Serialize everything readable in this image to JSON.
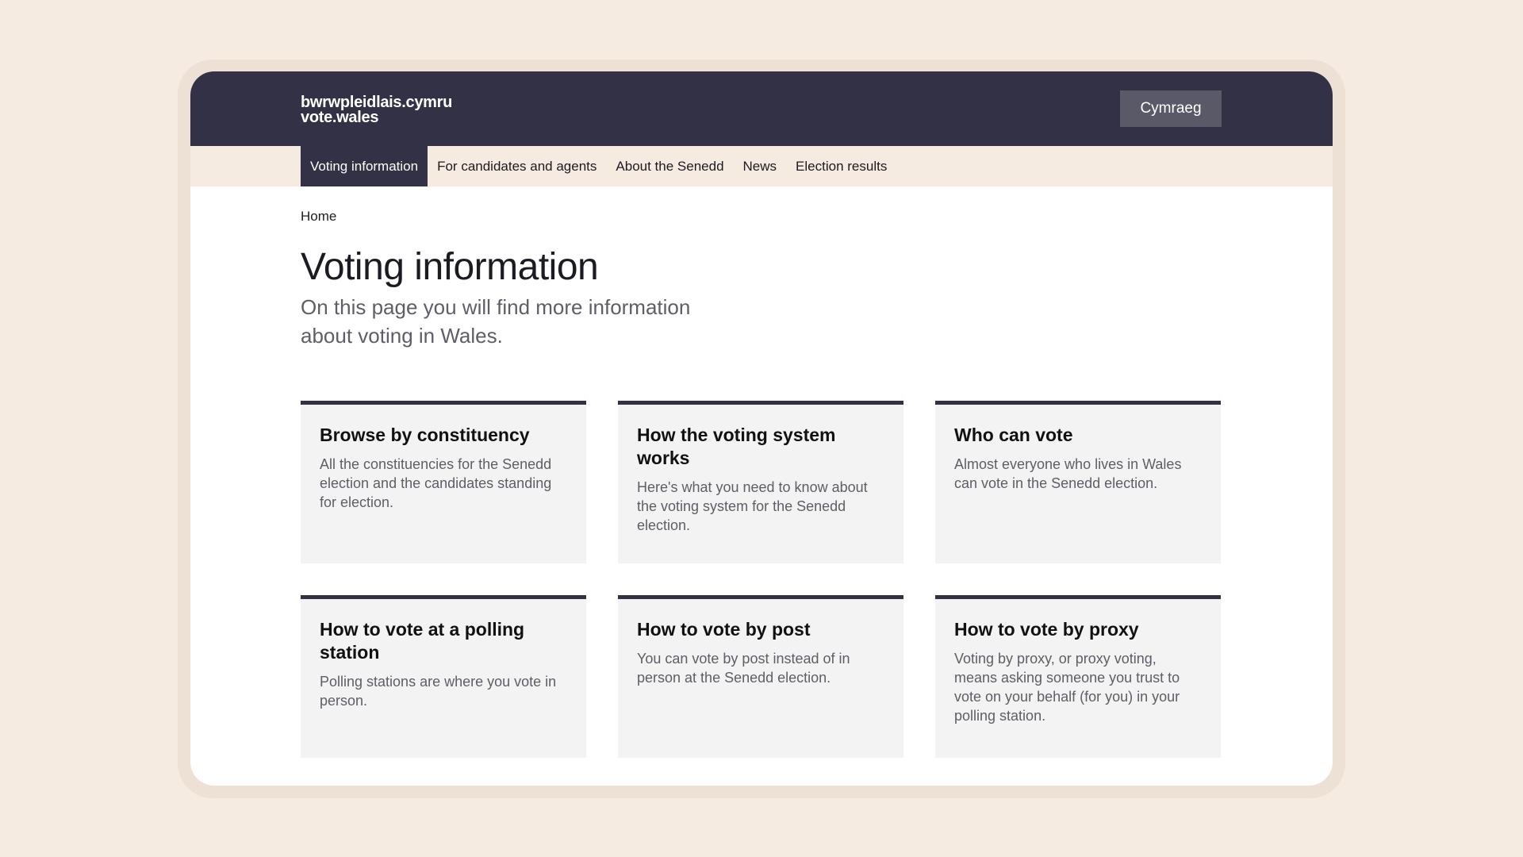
{
  "header": {
    "logo_line1": "bwrwpleidlais.cymru",
    "logo_line2": "vote.wales",
    "language_button": "Cymraeg"
  },
  "nav": {
    "items": [
      {
        "label": "Voting information",
        "active": true
      },
      {
        "label": "For candidates and agents",
        "active": false
      },
      {
        "label": "About the Senedd",
        "active": false
      },
      {
        "label": "News",
        "active": false
      },
      {
        "label": "Election results",
        "active": false
      }
    ]
  },
  "breadcrumb": {
    "home": "Home"
  },
  "page": {
    "title": "Voting information",
    "lead": "On this page you will find more information about voting in Wales."
  },
  "cards": [
    {
      "title": "Browse by constituency",
      "description": "All the constituencies for the Senedd election and the candidates standing for election."
    },
    {
      "title": "How the voting system works",
      "description": "Here's what you need to know about the voting system for the Senedd election."
    },
    {
      "title": "Who can vote",
      "description": "Almost everyone who lives in Wales can vote in the Senedd election."
    },
    {
      "title": "How to vote at a polling station",
      "description": "Polling stations are where you vote in person."
    },
    {
      "title": "How to vote by post",
      "description": "You can vote by post instead of in person at the Senedd election."
    },
    {
      "title": "How to vote by proxy",
      "description": "Voting by proxy, or proxy voting, means asking someone you trust to vote on your behalf (for you) in your polling station."
    }
  ],
  "colors": {
    "page_background": "#f6ebe0",
    "header_background": "#333146",
    "card_background": "#f3f3f3",
    "card_accent": "#333146",
    "language_button_background": "#5a5968"
  }
}
